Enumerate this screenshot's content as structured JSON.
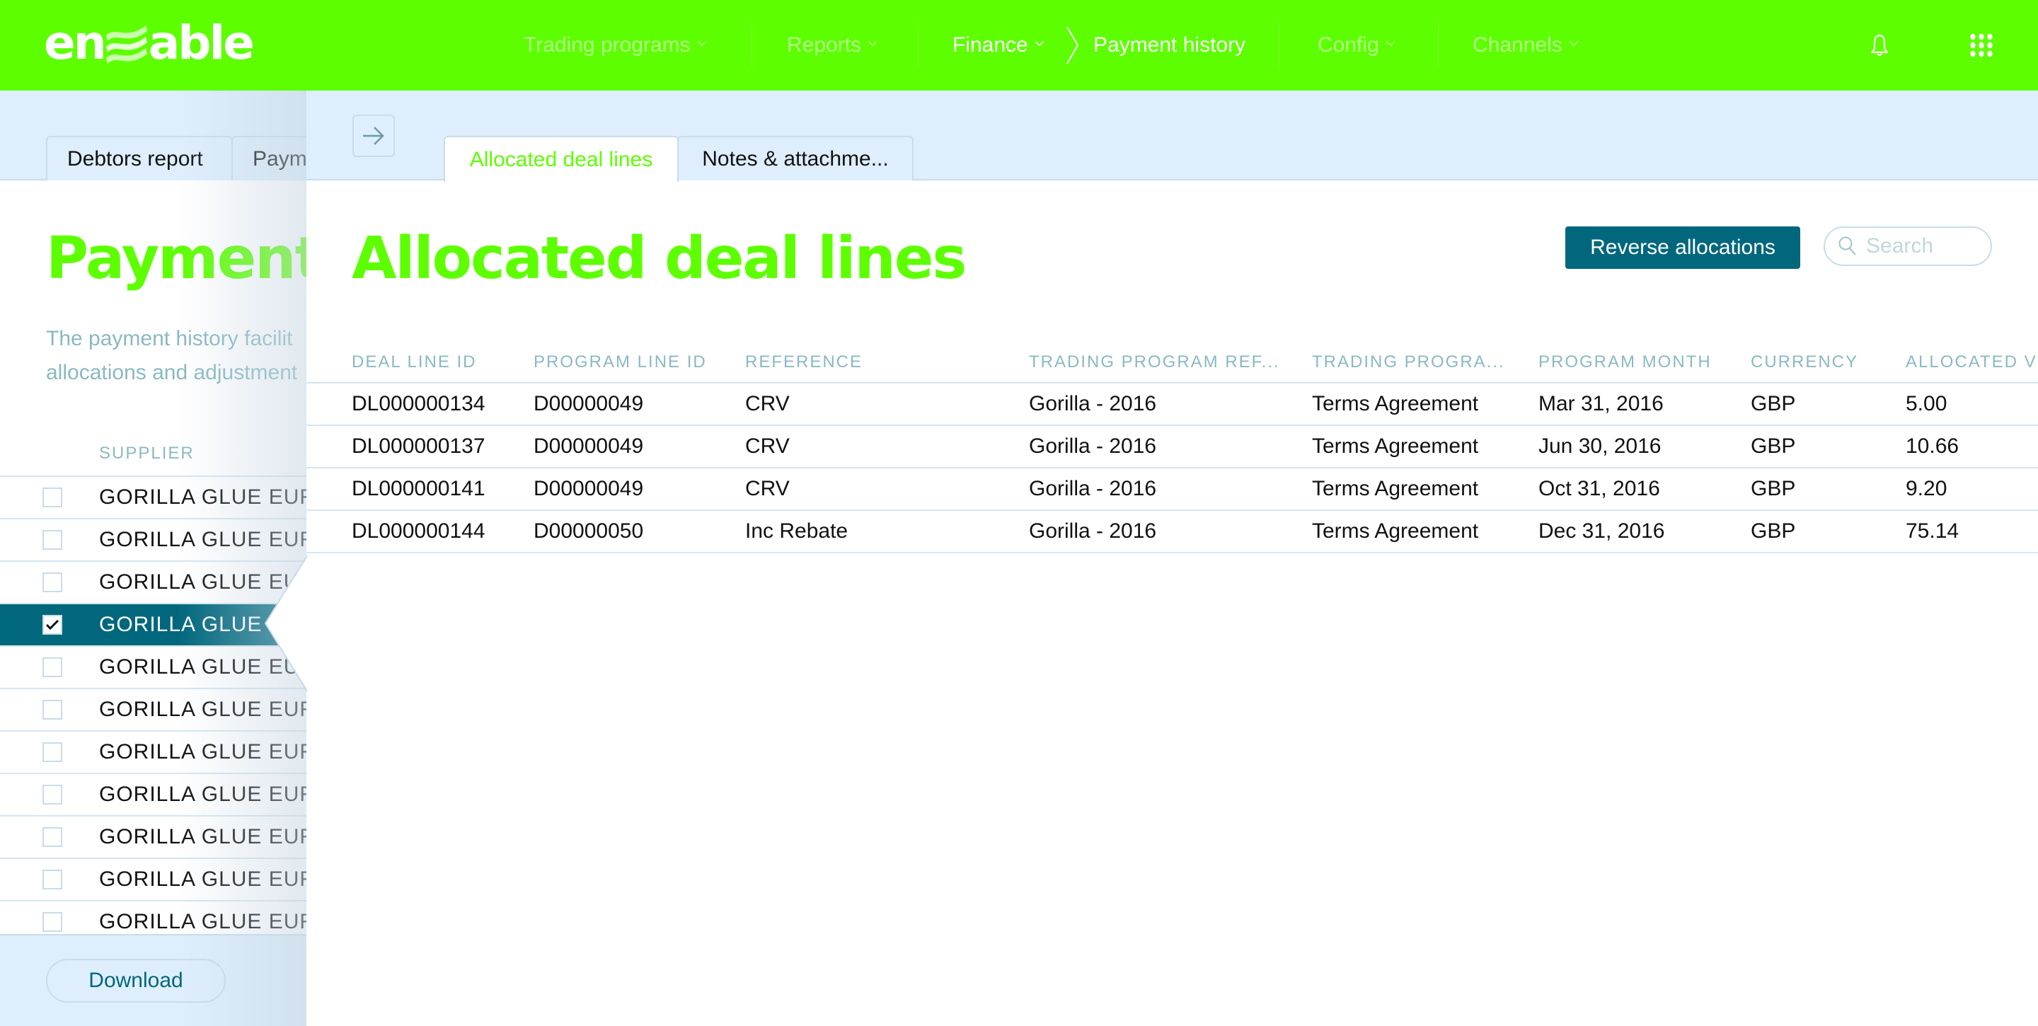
{
  "brand": {
    "logo_text_left": "en",
    "logo_text_right": "able",
    "accent": "#5dff00",
    "primary": "#00677d"
  },
  "topnav": {
    "items": [
      {
        "label": "Trading programs",
        "active": false
      },
      {
        "label": "Reports",
        "active": false
      },
      {
        "label": "Finance",
        "active": true
      },
      {
        "label": "Config",
        "active": false
      },
      {
        "label": "Channels",
        "active": false
      }
    ],
    "breadcrumb_current": "Payment history",
    "icons": {
      "notifications": "bell-icon",
      "apps": "grid-icon"
    }
  },
  "left_page": {
    "tabs": [
      {
        "label": "Debtors report"
      },
      {
        "label": "Paym"
      }
    ],
    "title": "Payment",
    "description_lines": [
      "The payment history facilit",
      "allocations and adjustment"
    ],
    "supplier_header": "SUPPLIER",
    "rows": [
      {
        "name": "GORILLA GLUE EURO",
        "checked": false
      },
      {
        "name": "GORILLA GLUE EURO",
        "checked": false
      },
      {
        "name": "GORILLA GLUE EUR",
        "checked": false
      },
      {
        "name": "GORILLA GLUE E",
        "checked": true
      },
      {
        "name": "GORILLA GLUE EUR",
        "checked": false
      },
      {
        "name": "GORILLA GLUE EURO",
        "checked": false
      },
      {
        "name": "GORILLA GLUE EURO",
        "checked": false
      },
      {
        "name": "GORILLA GLUE EURO",
        "checked": false
      },
      {
        "name": "GORILLA GLUE EURO",
        "checked": false
      },
      {
        "name": "GORILLA GLUE EURO",
        "checked": false
      },
      {
        "name": "GORILLA GLUE EURO",
        "checked": false
      }
    ],
    "download_label": "Download"
  },
  "panel": {
    "tabs": [
      {
        "label": "Allocated deal lines",
        "active": true
      },
      {
        "label": "Notes & attachme...",
        "active": false
      }
    ],
    "title": "Allocated deal lines",
    "reverse_label": "Reverse allocations",
    "search_placeholder": "Search",
    "search_value": "",
    "table": {
      "columns": [
        "DEAL LINE ID",
        "PROGRAM LINE ID",
        "REFERENCE",
        "TRADING PROGRAM REF...",
        "TRADING PROGRA...",
        "PROGRAM MONTH",
        "CURRENCY",
        "ALLOCATED V"
      ],
      "rows": [
        [
          "DL000000134",
          "D00000049",
          "CRV",
          "Gorilla - 2016",
          "Terms Agreement",
          "Mar 31, 2016",
          "GBP",
          "5.00"
        ],
        [
          "DL000000137",
          "D00000049",
          "CRV",
          "Gorilla - 2016",
          "Terms Agreement",
          "Jun 30, 2016",
          "GBP",
          "10.66"
        ],
        [
          "DL000000141",
          "D00000049",
          "CRV",
          "Gorilla - 2016",
          "Terms Agreement",
          "Oct 31, 2016",
          "GBP",
          "9.20"
        ],
        [
          "DL000000144",
          "D00000050",
          "Inc Rebate",
          "Gorilla - 2016",
          "Terms Agreement",
          "Dec 31, 2016",
          "GBP",
          "75.14"
        ]
      ]
    }
  }
}
